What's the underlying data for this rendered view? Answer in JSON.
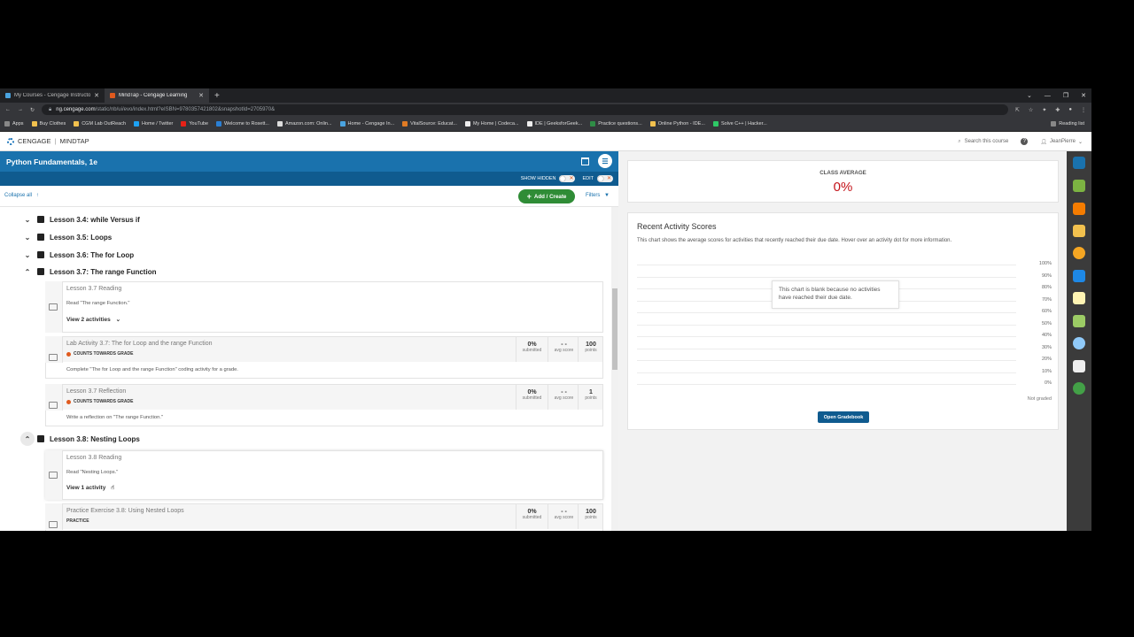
{
  "browser": {
    "tabs": [
      {
        "label": "My Courses - Cengage Instructo",
        "close": "✕"
      },
      {
        "label": "MindTap - Cengage Learning",
        "close": "✕"
      }
    ],
    "new_tab": "+",
    "url_host": "ng.cengage.com",
    "url_path": "/static/nb/ui/evo/index.html?eISBN=9780357421802&snapshotId=2705970&",
    "bookmarks": [
      "Apps",
      "Buy Clothes",
      "CGM Lab OutReach",
      "Home / Twitter",
      "YouTube",
      "Welcome to Rosett...",
      "Amazon.com: Onlin...",
      "Home - Cengage In...",
      "VitalSource: Educat...",
      "My Home | Codeca...",
      "IDE | GeeksforGeek...",
      "Practice questions...",
      "Online Python - IDE...",
      "Solve C++ | Hacker..."
    ],
    "reading_list": "Reading list"
  },
  "app": {
    "brand": "CENGAGE",
    "product": "MINDTAP",
    "search_placeholder": "Search this course",
    "user": "JeanPierre"
  },
  "course": {
    "title": "Python Fundamentals, 1e",
    "show_hidden": "SHOW HIDDEN",
    "edit": "EDIT",
    "collapse_all": "Collapse all",
    "add_create": "Add / Create",
    "filters": "Filters"
  },
  "outline": {
    "lessons": [
      {
        "label": "Lesson 3.4: while Versus if"
      },
      {
        "label": "Lesson 3.5: Loops"
      },
      {
        "label": "Lesson 3.6: The for Loop"
      },
      {
        "label": "Lesson 3.7: The range Function"
      },
      {
        "label": "Lesson 3.8: Nesting Loops"
      }
    ],
    "activities": [
      {
        "title": "Lesson 3.7 Reading",
        "desc": "Read \"The range Function.\"",
        "view": "View 2 activities"
      },
      {
        "title": "Lab Activity 3.7: The for Loop and the range Function",
        "badge": "COUNTS TOWARDS GRADE",
        "desc": "Complete \"The for Loop and the range Function\" coding activity for a grade.",
        "submitted": "0%",
        "submitted_label": "submitted",
        "avg": "- -",
        "avg_label": "avg score",
        "points": "100",
        "points_label": "points"
      },
      {
        "title": "Lesson 3.7 Reflection",
        "badge": "COUNTS TOWARDS GRADE",
        "desc": "Write a reflection on \"The range Function.\"",
        "submitted": "0%",
        "submitted_label": "submitted",
        "avg": "- -",
        "avg_label": "avg score",
        "points": "1",
        "points_label": "points"
      },
      {
        "title": "Lesson 3.8 Reading",
        "desc": "Read \"Nesting Loops.\"",
        "view": "View 1 activity"
      },
      {
        "title": "Practice Exercise 3.8: Using Nested Loops",
        "badge": "PRACTICE",
        "submitted": "0%",
        "submitted_label": "submitted",
        "avg": "- -",
        "avg_label": "avg score",
        "points": "100",
        "points_label": "points"
      }
    ]
  },
  "class_average": {
    "label": "CLASS AVERAGE",
    "value": "0%"
  },
  "recent_scores": {
    "title": "Recent Activity Scores",
    "desc": "This chart shows the average scores for activities that recently reached their due date. Hover over an activity dot for more information.",
    "y_ticks": [
      "100%",
      "90%",
      "80%",
      "70%",
      "60%",
      "50%",
      "40%",
      "30%",
      "20%",
      "10%",
      "0%"
    ],
    "blank_note": "This chart is blank because no activities have reached their due date.",
    "not_graded": "Not graded",
    "open_gradebook": "Open Gradebook"
  },
  "colors": {
    "brand_blue": "#1a72ad",
    "add_green": "#2f8c36",
    "grade_orange": "#e05a1e",
    "avg_red": "#c4141b"
  }
}
